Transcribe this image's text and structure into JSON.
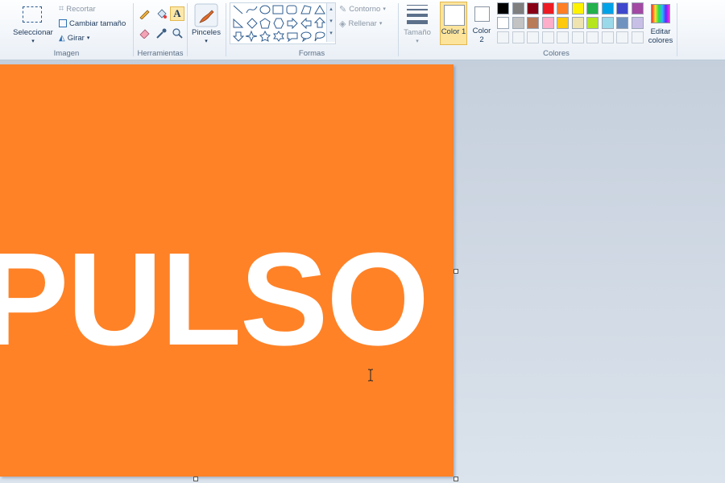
{
  "ribbon": {
    "image_group": {
      "label": "Imagen",
      "select_label": "Seleccionar",
      "crop_label": "Recortar",
      "resize_label": "Cambiar tamaño",
      "rotate_label": "Girar"
    },
    "tools_group": {
      "label": "Herramientas",
      "tools": [
        "pencil-icon",
        "fill-icon",
        "text-icon",
        "eraser-icon",
        "color-picker-icon",
        "magnifier-icon"
      ]
    },
    "brushes_label": "Pinceles",
    "shapes_group": {
      "label": "Formas",
      "outline_label": "Contorno",
      "fill_label": "Rellenar"
    },
    "size_label": "Tamaño",
    "colors_group": {
      "label": "Colores",
      "color1_label": "Color 1",
      "color1_value": "#ffffff",
      "color2_label": "Color 2",
      "color2_value": "#ffffff",
      "edit_colors_label": "Editar colores",
      "palette_row1": [
        "#000000",
        "#7f7f7f",
        "#880015",
        "#ed1c24",
        "#ff7f27",
        "#fff200",
        "#22b14c",
        "#00a2e8",
        "#3f48cc",
        "#a349a4"
      ],
      "palette_row2": [
        "#ffffff",
        "#c3c3c3",
        "#b97a57",
        "#ffaec9",
        "#ffc90e",
        "#efe4b0",
        "#b5e61d",
        "#99d9ea",
        "#7092be",
        "#c8bfe7"
      ]
    }
  },
  "canvas": {
    "background": "#ff8227",
    "text": "PULSO",
    "text_color": "#ffffff"
  }
}
